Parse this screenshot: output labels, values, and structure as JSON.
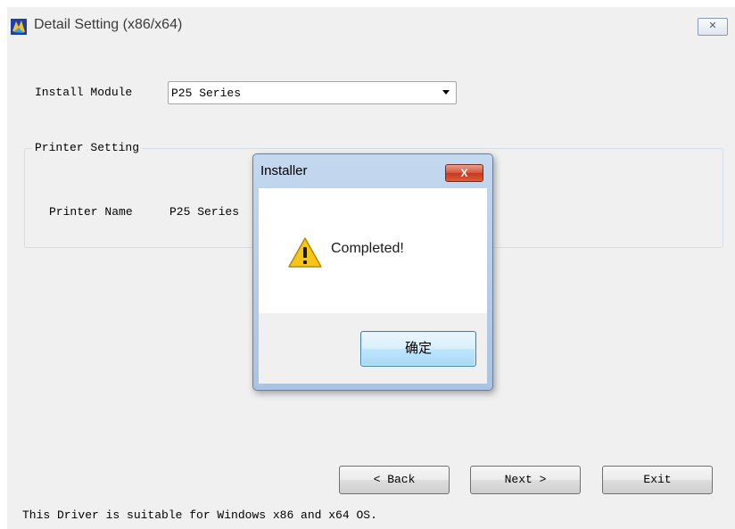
{
  "window": {
    "title": "Detail Setting (x86/x64)",
    "close_glyph": "✕"
  },
  "install_module": {
    "label": "Install Module",
    "selected": "P25 Series"
  },
  "printer_setting": {
    "group_label": "Printer Setting",
    "printer_name_label": "Printer Name",
    "printer_name_value": "P25 Series"
  },
  "buttons": {
    "back": "< Back",
    "next": "Next >",
    "exit": "Exit"
  },
  "footer": {
    "note": "This Driver is suitable for Windows x86 and x64 OS."
  },
  "dialog": {
    "title": "Installer",
    "close_glyph": "X",
    "message": "Completed!",
    "icon": "warning-icon",
    "ok_label": "确定"
  }
}
